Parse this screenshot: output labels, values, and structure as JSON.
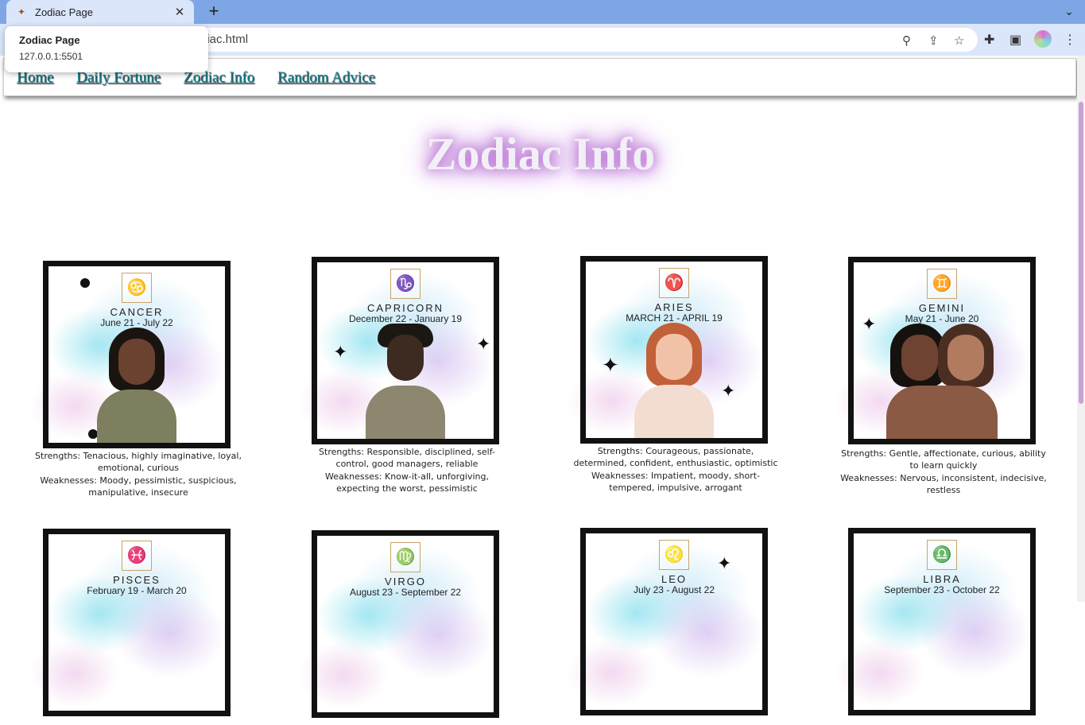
{
  "browser": {
    "tab_title": "Zodiac Page",
    "url": "diac.html",
    "hover_title": "Zodiac Page",
    "hover_url": "127.0.0.1:5501"
  },
  "nav": {
    "items": [
      "Home",
      "Daily Fortune",
      "Zodiac Info",
      "Random Advice"
    ]
  },
  "heading": "Zodiac Info",
  "signs": [
    {
      "name": "CANCER",
      "dates": "June 21 - July 22",
      "strengths": "Strengths: Tenacious, highly imaginative, loyal, emotional, curious",
      "weaknesses": "Weaknesses: Moody, pessimistic, suspicious, manipulative, insecure",
      "emblem": "crab-icon"
    },
    {
      "name": "CAPRICORN",
      "dates": "December 22 - January 19",
      "strengths": "Strengths: Responsible, disciplined, self-control, good managers, reliable",
      "weaknesses": "Weaknesses: Know-it-all, unforgiving, expecting the worst, pessimistic",
      "emblem": "goat-icon"
    },
    {
      "name": "ARIES",
      "dates": "MARCH 21 - APRIL 19",
      "strengths": "Strengths: Courageous, passionate, determined, confident, enthusiastic, optimistic",
      "weaknesses": "Weaknesses: Impatient, moody, short-tempered, impulsive, arrogant",
      "emblem": "ram-icon"
    },
    {
      "name": "GEMINI",
      "dates": "May 21 - June 20",
      "strengths": "Strengths: Gentle, affectionate, curious, ability to learn quickly",
      "weaknesses": "Weaknesses: Nervous, inconsistent, indecisive, restless",
      "emblem": "twins-icon"
    },
    {
      "name": "PISCES",
      "dates": "February 19 - March 20",
      "emblem": "fish-icon"
    },
    {
      "name": "VIRGO",
      "dates": "August 23 - September 22",
      "emblem": "maiden-icon"
    },
    {
      "name": "LEO",
      "dates": "July 23 - August 22",
      "emblem": "lion-icon"
    },
    {
      "name": "LIBRA",
      "dates": "September 23 - October 22",
      "emblem": "scales-icon"
    }
  ],
  "colors": {
    "nav_link": "#0a7d8c",
    "heading_glow": "#b46ad1",
    "tabbar": "#7fa6e4"
  }
}
